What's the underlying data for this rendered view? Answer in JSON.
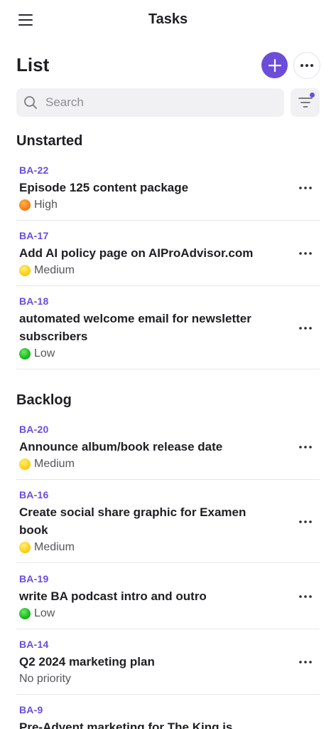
{
  "header": {
    "title": "Tasks"
  },
  "list": {
    "title": "List"
  },
  "search": {
    "placeholder": "Search"
  },
  "sections": [
    {
      "title": "Unstarted",
      "tasks": [
        {
          "id": "BA-22",
          "title": "Episode 125 content package",
          "priority": "High"
        },
        {
          "id": "BA-17",
          "title": "Add AI policy page on AIProAdvisor.com",
          "priority": "Medium"
        },
        {
          "id": "BA-18",
          "title": "automated welcome email for newsletter subscribers",
          "priority": "Low"
        }
      ]
    },
    {
      "title": "Backlog",
      "tasks": [
        {
          "id": "BA-20",
          "title": "Announce album/book release date",
          "priority": "Medium"
        },
        {
          "id": "BA-16",
          "title": "Create social share graphic for Examen book",
          "priority": "Medium"
        },
        {
          "id": "BA-19",
          "title": "write BA podcast intro and outro",
          "priority": "Low"
        },
        {
          "id": "BA-14",
          "title": "Q2 2024 marketing plan",
          "priority": "No priority"
        },
        {
          "id": "BA-9",
          "title": "Pre-Advent marketing for The King is",
          "priority": ""
        }
      ]
    }
  ],
  "colors": {
    "accent": "#6b4dd8",
    "high": "#f5841d",
    "medium": "#ffd21a",
    "low": "#1fbe1f"
  }
}
